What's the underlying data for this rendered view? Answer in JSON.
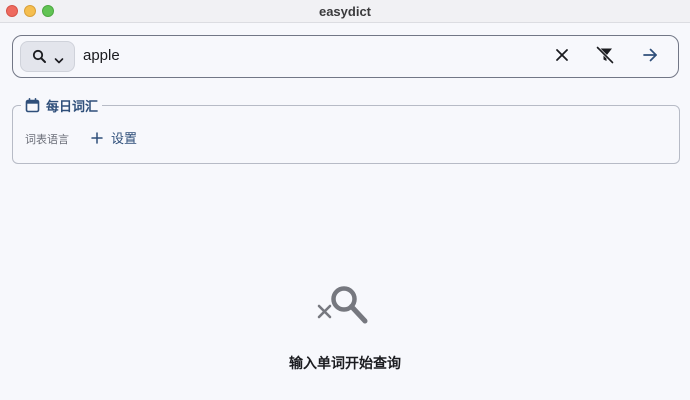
{
  "window": {
    "title": "easydict"
  },
  "search": {
    "query": "apple",
    "mode_icon": "search-icon",
    "dropdown_icon": "chevron-down-icon",
    "clear_icon": "close-icon",
    "filter_icon": "filter-off-icon",
    "submit_icon": "arrow-right-icon"
  },
  "daily_words": {
    "title": "每日词汇",
    "title_icon": "calendar-icon",
    "language_label": "词表语言",
    "settings_label": "设置",
    "settings_icon": "plus-icon"
  },
  "empty_state": {
    "icon": "search-off-icon",
    "message": "输入单词开始查询"
  },
  "colors": {
    "accent": "#2f4f7a",
    "background": "#f7f8fc",
    "border": "#727786"
  }
}
